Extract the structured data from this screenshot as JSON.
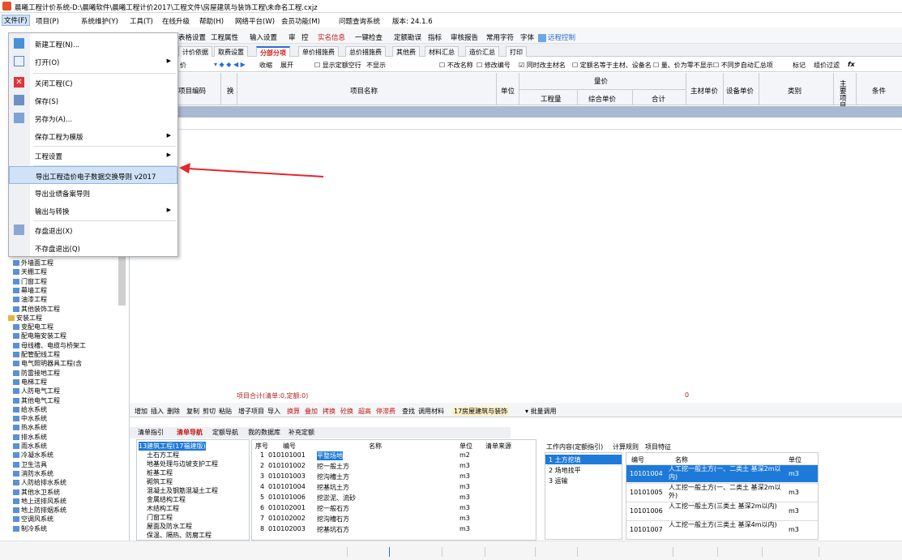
{
  "title": "晨曦工程计价系统-D:\\晨曦软件\\晨曦工程计价2017\\工程文件\\房屋建筑与装饰工程\\未命名工程.cxjz",
  "menubar": [
    "文件(F)",
    "项目(P)",
    "系统维护(Y)",
    "工具(T)",
    "在线升级",
    "帮助(H)",
    "网络平台(W)",
    "会员功能(M)",
    "问题查询系统",
    "版本: 24.1.6"
  ],
  "toolbar2": [
    "表格设置",
    "工程属性",
    "输入设置",
    "审",
    "控",
    "实名信息",
    "一键检查",
    "定额勘误",
    "指标",
    "审核报告",
    "常用字符",
    "字体",
    "远程控制"
  ],
  "tabs": [
    "计价依据",
    "取费设置",
    "分部分项",
    "单价措施费",
    "总价措施费",
    "其他费",
    "材料汇总",
    "造价汇总",
    "打印"
  ],
  "active_tab": "分部分项",
  "options": [
    "价",
    "收缩",
    "展开",
    "显示定额空行",
    "不显示",
    "不改名称",
    "修改编号",
    "同时改主材名",
    "定额名等于主材、设备名",
    "量、价为零不显示",
    "不同步自动汇总项",
    "标记",
    "组价过滤"
  ],
  "grid_headers": {
    "code": "项目编码",
    "swap": "换",
    "name": "项目名称",
    "unit": "单位",
    "qty_group": "量价",
    "qty": "工程量",
    "unit_price": "综合单价",
    "total": "合计",
    "main_price": "主材单价",
    "equip_price": "设备单价",
    "category": "类别",
    "main": "主要项目",
    "cond": "条件"
  },
  "file_menu": [
    {
      "label": "新建工程(N)...",
      "icon": "new-file-icon",
      "arrow": false
    },
    {
      "label": "打开(O)",
      "icon": "folder-icon",
      "arrow": true
    },
    {
      "label": "关闭工程(C)",
      "icon": "close-icon",
      "arrow": false
    },
    {
      "label": "保存(S)",
      "icon": "save-icon",
      "arrow": false
    },
    {
      "label": "另存为(A)...",
      "icon": "save-as-icon",
      "arrow": false
    },
    {
      "label": "保存工程为模版",
      "icon": "",
      "arrow": true
    },
    {
      "label": "工程设置",
      "icon": "",
      "arrow": true
    },
    {
      "label": "导出工程造价电子数据交换导则 v2017",
      "icon": "",
      "arrow": false,
      "highlight": true
    },
    {
      "label": "导出业绩备案导则",
      "icon": "",
      "arrow": false
    },
    {
      "label": "输出与转换",
      "icon": "",
      "arrow": true
    },
    {
      "label": "存盘退出(X)",
      "icon": "save-exit-icon",
      "arrow": false
    },
    {
      "label": "不存盘退出(Q)",
      "icon": "",
      "arrow": false
    }
  ],
  "tree_items": [
    {
      "label": "外墙面工程",
      "fold": false
    },
    {
      "label": "天棚工程",
      "fold": false
    },
    {
      "label": "门窗工程",
      "fold": false
    },
    {
      "label": "幕墙工程",
      "fold": false
    },
    {
      "label": "油漆工程",
      "fold": false
    },
    {
      "label": "其他装饰工程",
      "fold": false
    },
    {
      "label": "安装工程",
      "fold": true
    },
    {
      "label": "变配电工程",
      "fold": false
    },
    {
      "label": "配电箱安装工程",
      "fold": false
    },
    {
      "label": "母线槽、电缆与桥架工",
      "fold": false
    },
    {
      "label": "配管配线工程",
      "fold": false
    },
    {
      "label": "电气照明器具工程(含",
      "fold": false
    },
    {
      "label": "防雷接地工程",
      "fold": false
    },
    {
      "label": "电梯工程",
      "fold": false
    },
    {
      "label": "人防电气工程",
      "fold": false
    },
    {
      "label": "其他电气工程",
      "fold": false
    },
    {
      "label": "给水系统",
      "fold": false
    },
    {
      "label": "中水系统",
      "fold": false
    },
    {
      "label": "热水系统",
      "fold": false
    },
    {
      "label": "排水系统",
      "fold": false
    },
    {
      "label": "雨水系统",
      "fold": false
    },
    {
      "label": "冷凝水系统",
      "fold": false
    },
    {
      "label": "卫生洁具",
      "fold": false
    },
    {
      "label": "消防水系统",
      "fold": false
    },
    {
      "label": "人防给排水系统",
      "fold": false
    },
    {
      "label": "其他水卫系统",
      "fold": false
    },
    {
      "label": "地上送排风系统",
      "fold": false
    },
    {
      "label": "地上防排烟系统",
      "fold": false
    },
    {
      "label": "空调风系统",
      "fold": false
    },
    {
      "label": "制冷系统",
      "fold": false
    }
  ],
  "summary": "项目合计(清单:0,定额:0)",
  "summary_value": "0",
  "actions": [
    "增加",
    "插入",
    "删除",
    "复制",
    "剪切",
    "粘贴",
    "增子项目",
    "导入",
    "换算",
    "叠加",
    "拷换",
    "砼换",
    "超高",
    "停滞费",
    "查找",
    "调用材料",
    "17房屋建筑与装饰",
    "批量调用"
  ],
  "bottom_tabs": [
    "清单指引",
    "清单导航",
    "定额导航",
    "我的数据库",
    "补充定额"
  ],
  "active_bottom_tab": "清单导航",
  "left_tree": [
    "13建筑工程(17福建版)",
    "土石方工程",
    "地基处理与边坡支护工程",
    "桩基工程",
    "砌筑工程",
    "混凝土及钢筋混凝土工程",
    "金属结构工程",
    "木结构工程",
    "门窗工程",
    "屋面及防水工程",
    "保温、隔热、防腐工程"
  ],
  "list_headers": {
    "seq": "序号",
    "code": "编号",
    "name": "名称",
    "unit": "单位",
    "source": "清单来源"
  },
  "list_rows": [
    {
      "seq": "1",
      "code": "010101001",
      "name": "平整场地",
      "unit": "m2"
    },
    {
      "seq": "2",
      "code": "010101002",
      "name": "挖一般土方",
      "unit": "m3"
    },
    {
      "seq": "3",
      "code": "010101003",
      "name": "挖沟槽土方",
      "unit": "m3"
    },
    {
      "seq": "4",
      "code": "010101004",
      "name": "挖基坑土方",
      "unit": "m3"
    },
    {
      "seq": "5",
      "code": "010101006",
      "name": "挖淤泥、流砂",
      "unit": "m3"
    },
    {
      "seq": "6",
      "code": "010102001",
      "name": "挖一般石方",
      "unit": "m3"
    },
    {
      "seq": "7",
      "code": "010102002",
      "name": "挖沟槽石方",
      "unit": "m3"
    },
    {
      "seq": "8",
      "code": "010102003",
      "name": "挖基坑石方",
      "unit": "m3"
    }
  ],
  "right_tabs": [
    "工作内容(定额指引)",
    "计算规则",
    "项目特征"
  ],
  "work_items": [
    "1 土方挖填",
    "2 场地找平",
    "3 运输"
  ],
  "quota_headers": {
    "code": "编号",
    "name": "名称",
    "unit": "单位"
  },
  "quota_rows": [
    {
      "code": "10101004",
      "name": "人工挖一般土方(一、二类土 基深2m以内)",
      "unit": "m3",
      "sel": true
    },
    {
      "code": "10101005",
      "name": "人工挖一般土方(一、二类土 基深2m以外)",
      "unit": "m3",
      "sel": false
    },
    {
      "code": "10101006",
      "name": "人工挖一般土方(三类土 基深2m以内)",
      "unit": "m3",
      "sel": false
    },
    {
      "code": "10101007",
      "name": "人工挖一般土方(三类土 基深4m以内)",
      "unit": "m3",
      "sel": false
    }
  ],
  "colors": {
    "accent": "#2b6cd6",
    "highlight": "#cfe2f7",
    "arrow": "#e8242c",
    "selected_row": "#1e7ad9"
  }
}
